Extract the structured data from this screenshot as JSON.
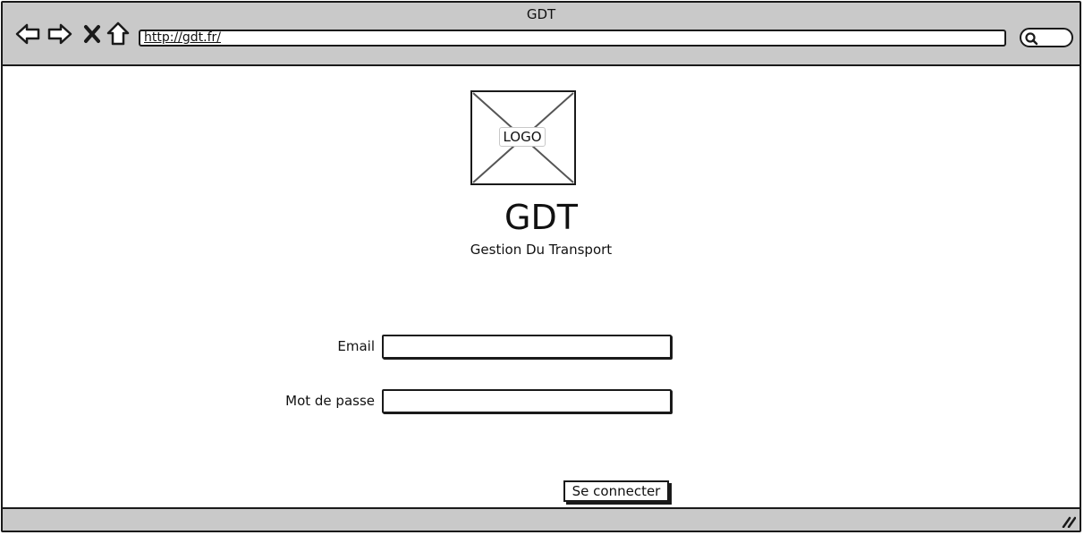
{
  "window": {
    "title": "GDT"
  },
  "toolbar": {
    "back_icon": "back-arrow-icon",
    "forward_icon": "forward-arrow-icon",
    "stop_icon": "close-icon",
    "home_icon": "home-icon",
    "url": "http://gdt.fr/",
    "search_icon": "search-icon"
  },
  "header": {
    "logo_label": "LOGO",
    "app_name": "GDT",
    "tagline": "Gestion Du Transport"
  },
  "login_form": {
    "email_label": "Email",
    "email_value": "",
    "password_label": "Mot de passe",
    "password_value": "",
    "submit_label": "Se connecter"
  },
  "statusbar": {
    "resize_icon": "resize-grip-icon"
  }
}
